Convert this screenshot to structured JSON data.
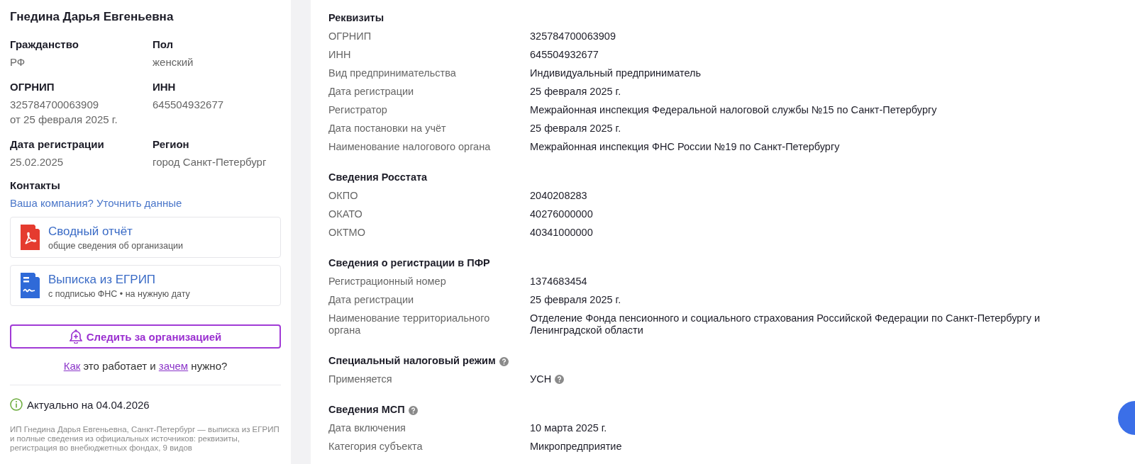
{
  "sidebar": {
    "name": "Гнедина Дарья Евгеньевна",
    "fields": [
      {
        "label": "Гражданство",
        "lines": [
          "РФ"
        ]
      },
      {
        "label": "Пол",
        "lines": [
          "женский"
        ]
      },
      {
        "label": "ОГРНИП",
        "lines": [
          "325784700063909",
          "от 25 февраля 2025 г."
        ]
      },
      {
        "label": "ИНН",
        "lines": [
          "645504932677"
        ]
      },
      {
        "label": "Дата регистрации",
        "lines": [
          "25.02.2025"
        ]
      },
      {
        "label": "Регион",
        "lines": [
          "город Санкт-Петербург"
        ]
      }
    ],
    "contacts": {
      "title": "Контакты",
      "link": "Ваша компания? Уточнить данные"
    },
    "documents": [
      {
        "kind": "pdf",
        "title": "Сводный отчёт",
        "subtitle": "общие сведения об организации"
      },
      {
        "kind": "doc",
        "title": "Выписка из ЕГРИП",
        "subtitle": "с подписью ФНС • на нужную дату"
      }
    ],
    "follow_button": "Следить за организацией",
    "help": [
      {
        "kind": "link",
        "text": "Как"
      },
      {
        "kind": "text",
        "text": " это работает и "
      },
      {
        "kind": "link",
        "text": "зачем"
      },
      {
        "kind": "text",
        "text": " нужно?"
      }
    ],
    "updated": "Актуально на 04.04.2026",
    "description": "ИП Гнедина Дарья Евгеньевна, Санкт-Петербург — выписка из ЕГРИП и полные сведения из официальных источников: реквизиты, регистрация во внебюджетных фондах, 9 видов"
  },
  "sections": [
    {
      "title": "Реквизиты",
      "help_icon": false,
      "rows": [
        {
          "label": "ОГРНИП",
          "value": "325784700063909",
          "help_icon": false
        },
        {
          "label": "ИНН",
          "value": "645504932677",
          "help_icon": false
        },
        {
          "label": "Вид предпринимательства",
          "value": "Индивидуальный предприниматель",
          "help_icon": false
        },
        {
          "label": "Дата регистрации",
          "value": "25 февраля 2025 г.",
          "help_icon": false
        },
        {
          "label": "Регистратор",
          "value": "Межрайонная инспекция Федеральной налоговой службы №15 по Санкт-Петербургу",
          "help_icon": false
        },
        {
          "label": "Дата постановки на учёт",
          "value": "25 февраля 2025 г.",
          "help_icon": false
        },
        {
          "label": "Наименование налогового органа",
          "value": "Межрайонная инспекция ФНС России №19 по Санкт-Петербургу",
          "help_icon": false
        }
      ]
    },
    {
      "title": "Сведения Росстата",
      "help_icon": false,
      "rows": [
        {
          "label": "ОКПО",
          "value": "2040208283",
          "help_icon": false
        },
        {
          "label": "ОКАТО",
          "value": "40276000000",
          "help_icon": false
        },
        {
          "label": "ОКТМО",
          "value": "40341000000",
          "help_icon": false
        }
      ]
    },
    {
      "title": "Сведения о регистрации в ПФР",
      "help_icon": false,
      "rows": [
        {
          "label": "Регистрационный номер",
          "value": "1374683454",
          "help_icon": false
        },
        {
          "label": "Дата регистрации",
          "value": "25 февраля 2025 г.",
          "help_icon": false
        },
        {
          "label": "Наименование территориального органа",
          "value": "Отделение Фонда пенсионного и социального страхования Российской Федерации по Санкт-Петербургу и Ленинградской области",
          "help_icon": false
        }
      ]
    },
    {
      "title": "Специальный налоговый режим",
      "help_icon": true,
      "rows": [
        {
          "label": "Применяется",
          "value": "УСН",
          "help_icon": true
        }
      ]
    },
    {
      "title": "Сведения МСП",
      "help_icon": true,
      "rows": [
        {
          "label": "Дата включения",
          "value": "10 марта 2025 г.",
          "help_icon": false
        },
        {
          "label": "Категория субъекта",
          "value": "Микропредприятие",
          "help_icon": false
        }
      ]
    }
  ]
}
